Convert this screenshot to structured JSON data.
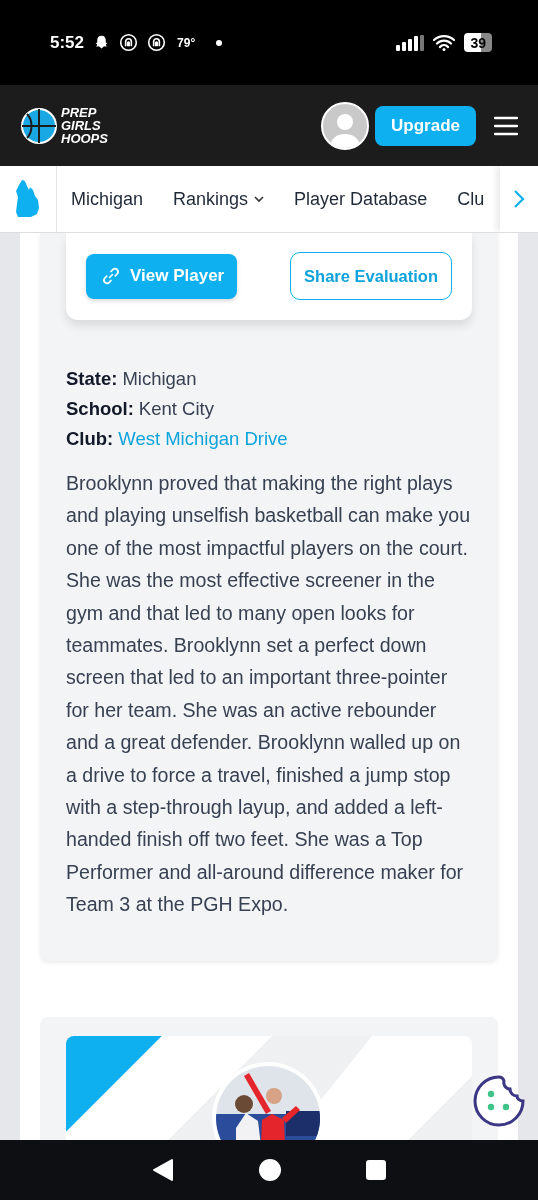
{
  "status_bar": {
    "time": "5:52",
    "temperature": "79°",
    "battery": "39"
  },
  "header": {
    "logo_lines": [
      "PREP",
      "GIRLS",
      "HOOPS"
    ],
    "upgrade_button": "Upgrade"
  },
  "nav": {
    "items": [
      {
        "label": "Michigan",
        "dropdown": false
      },
      {
        "label": "Rankings",
        "dropdown": true
      },
      {
        "label": "Player Database",
        "dropdown": false
      },
      {
        "label": "Clu",
        "dropdown": false
      }
    ]
  },
  "actions": {
    "view_player": "View Player",
    "share": "Share Evaluation"
  },
  "details": [
    {
      "label": "State:",
      "value": "Michigan",
      "kind": "text"
    },
    {
      "label": "School:",
      "value": "Kent City",
      "kind": "text"
    },
    {
      "label": "Club:",
      "value": "West Michigan Drive",
      "kind": "link"
    }
  ],
  "evaluation": "Brooklynn proved that making the right plays and playing unselfish basketball can make you one of the most impactful players on the court. She was the most effective screener in the gym and that led to many open looks for teammates. Brooklynn set a perfect down screen that led to an important three-pointer for her team. She was an active rebounder and a great defender. Brooklynn walled up on a drive to force a travel, finished a jump stop with a step-through layup, and added a left-handed finish off two feet. She was a Top Performer and all-around difference maker for Team 3 at the PGH Expo."
}
